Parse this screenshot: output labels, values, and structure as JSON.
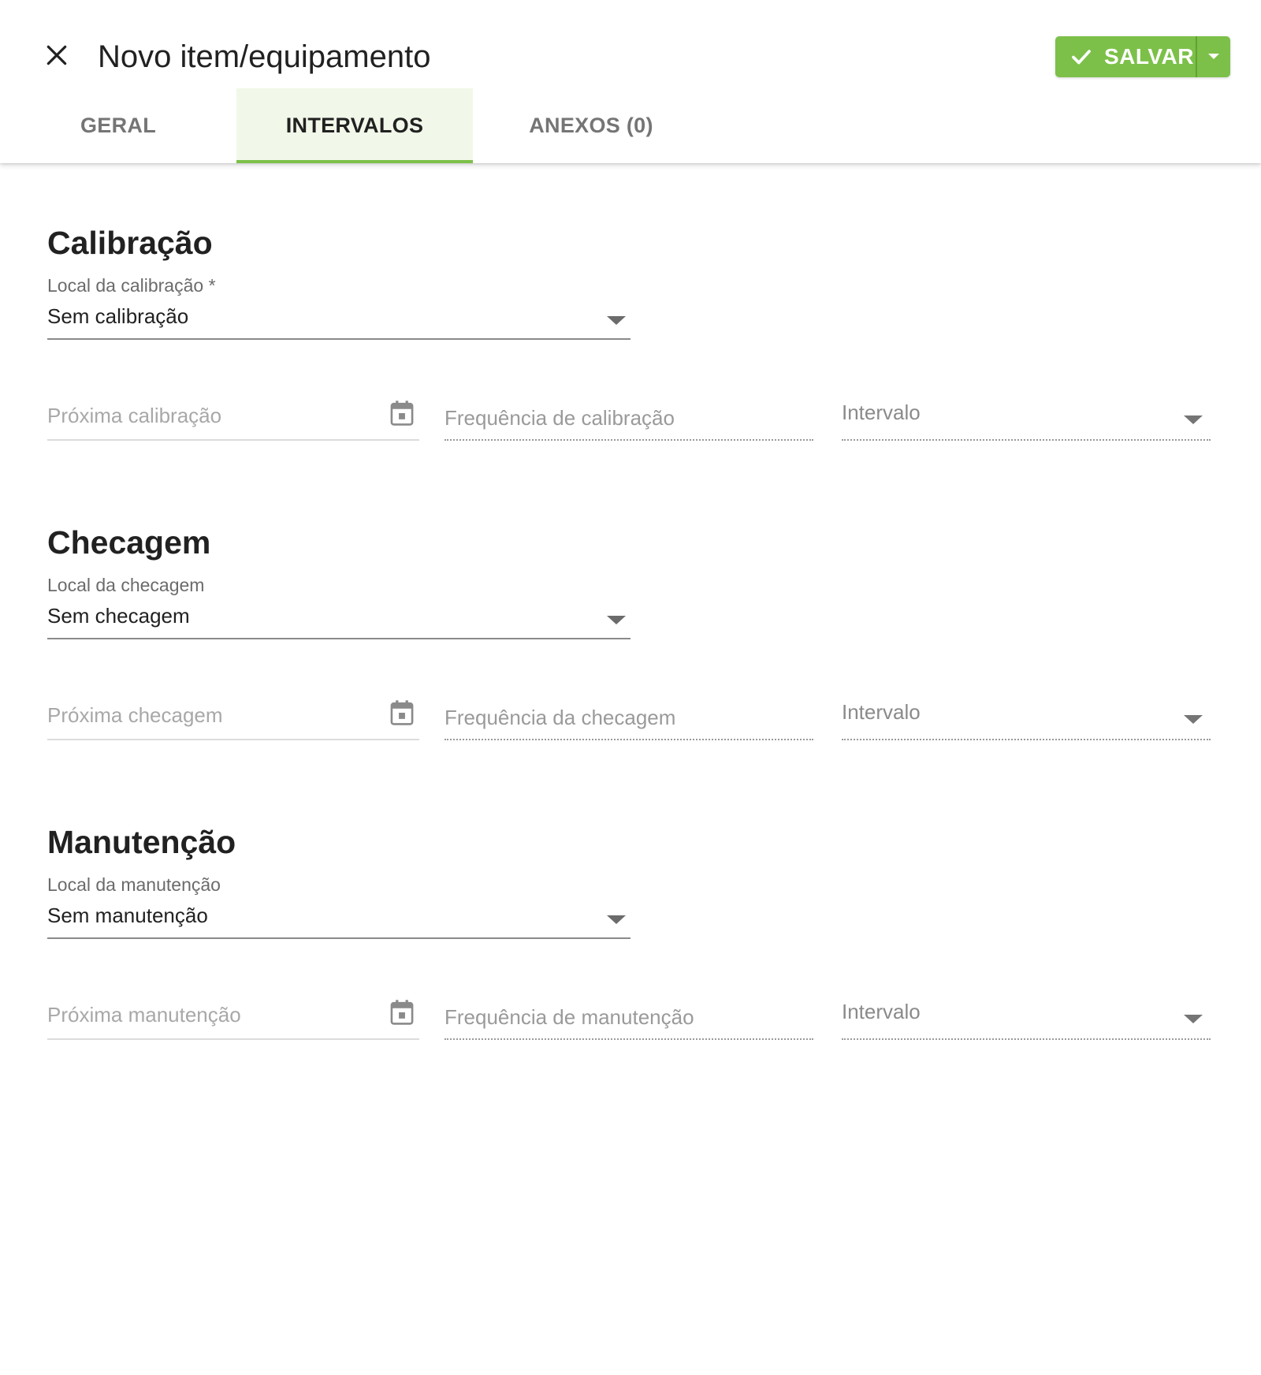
{
  "header": {
    "title": "Novo item/equipamento",
    "save_label": "SALVAR",
    "accent_color": "#7cc049"
  },
  "tabs": [
    {
      "label": "GERAL",
      "active": false
    },
    {
      "label": "INTERVALOS",
      "active": true
    },
    {
      "label": "ANEXOS (0)",
      "active": false
    }
  ],
  "sections": {
    "calibracao": {
      "title": "Calibração",
      "local_label": "Local da calibração *",
      "local_value": "Sem calibração",
      "next_placeholder": "Próxima calibração",
      "freq_placeholder": "Frequência de calibração",
      "interval_placeholder": "Intervalo"
    },
    "checagem": {
      "title": "Checagem",
      "local_label": "Local da checagem",
      "local_value": "Sem checagem",
      "next_placeholder": "Próxima checagem",
      "freq_placeholder": "Frequência da checagem",
      "interval_placeholder": "Intervalo"
    },
    "manutencao": {
      "title": "Manutenção",
      "local_label": "Local da manutenção",
      "local_value": "Sem manutenção",
      "next_placeholder": "Próxima manutenção",
      "freq_placeholder": "Frequência de manutenção",
      "interval_placeholder": "Intervalo"
    }
  },
  "icons": [
    "close-icon",
    "check-icon",
    "chevron-down-icon",
    "calendar-icon"
  ]
}
